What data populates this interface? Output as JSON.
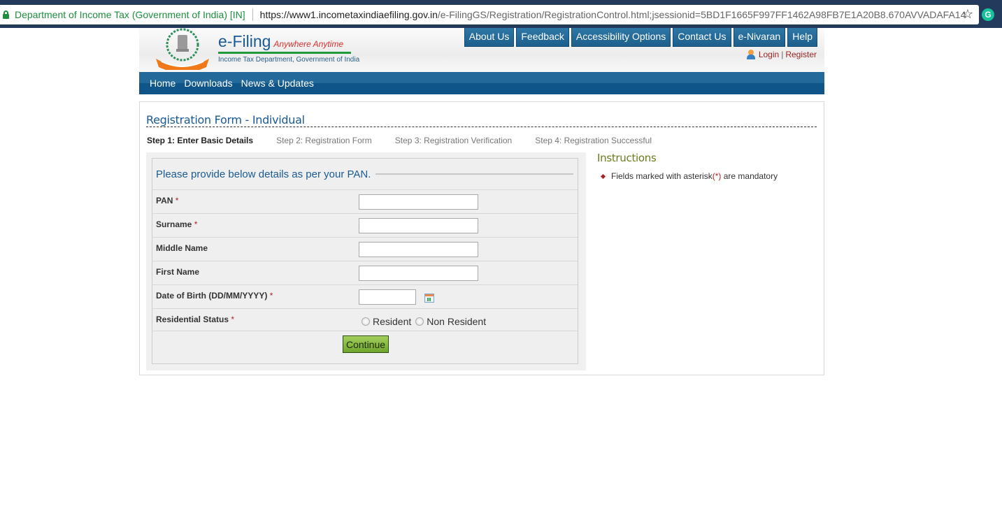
{
  "browser": {
    "site_identity": "Department of Income Tax (Government of India) [IN]",
    "url_host": "https://www1.incometaxindiaefiling.gov.in",
    "url_path": "/e-FilingGS/Registration/RegistrationControl.html;jsessionid=5BD1F1665F997FF1462A98FB7E1A20B8.670AVVADAFA14",
    "extension_letter": "G"
  },
  "header": {
    "brand_title": "e-Filing",
    "brand_tagline": "Anywhere Anytime",
    "brand_subtitle": "Income Tax Department, Government of India",
    "top_links": [
      "About Us",
      "Feedback",
      "Accessibility Options",
      "Contact Us",
      "e-Nivaran",
      "Help"
    ],
    "login": "Login",
    "separator": "|",
    "register": "Register"
  },
  "nav": {
    "items": [
      "Home",
      "Downloads",
      "News & Updates"
    ]
  },
  "page": {
    "title": "Registration Form - Individual",
    "steps": [
      {
        "label": "Step 1: Enter Basic Details",
        "active": true
      },
      {
        "label": "Step 2: Registration Form",
        "active": false
      },
      {
        "label": "Step 3: Registration Verification",
        "active": false
      },
      {
        "label": "Step 4: Registration Successful",
        "active": false
      }
    ]
  },
  "form": {
    "heading": "Please provide below details as per your PAN.",
    "required_marker": "*",
    "fields": {
      "pan": {
        "label": "PAN",
        "value": "",
        "required": true
      },
      "surname": {
        "label": "Surname",
        "value": "",
        "required": true
      },
      "middle_name": {
        "label": "Middle Name",
        "value": "",
        "required": false
      },
      "first_name": {
        "label": "First Name",
        "value": "",
        "required": false
      },
      "dob": {
        "label": "Date of Birth (DD/MM/YYYY)",
        "value": "",
        "required": true
      },
      "residential_status": {
        "label": "Residential Status",
        "required": true,
        "options": [
          "Resident",
          "Non Resident"
        ],
        "selected": null
      }
    },
    "continue_label": "Continue"
  },
  "instructions": {
    "title": "Instructions",
    "items": [
      {
        "pre": "Fields marked with asterisk",
        "marker": "(*)",
        "post": " are mandatory"
      }
    ]
  }
}
